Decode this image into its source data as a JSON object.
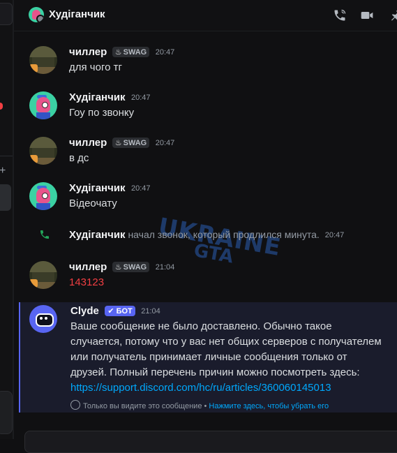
{
  "header": {
    "title": "Худіганчик"
  },
  "messages": [
    {
      "author": "чиллер",
      "tag": "SWAG",
      "time": "20:47",
      "text": "для чого тг"
    },
    {
      "author": "Худіганчик",
      "time": "20:47",
      "text": "Гоу по звонку"
    },
    {
      "author": "чиллер",
      "tag": "SWAG",
      "time": "20:47",
      "text": "в дс"
    },
    {
      "author": "Худіганчик",
      "time": "20:47",
      "text": "Відеочату"
    },
    {
      "author": "чиллер",
      "tag": "SWAG",
      "time": "21:04",
      "text": "143123"
    }
  ],
  "call": {
    "author": "Худіганчик",
    "text": "начал звонок, который продлился минута.",
    "time": "20:47"
  },
  "clyde": {
    "author": "Clyde",
    "badge": "✔ БОТ",
    "time": "21:04",
    "text": "Ваше сообщение не было доставлено. Обычно такое случается, потому что у вас нет общих серверов с получателем или получатель принимает личные сообщения только от друзей. Полный перечень причин можно посмотреть здесь:",
    "link": "https://support.discord.com/hc/ru/articles/360060145013",
    "ephemeral_note": "Только вы видите это сообщение •",
    "dismiss_label": "Нажмите здесь, чтобы убрать его"
  },
  "watermark": {
    "line1": "UKRAINE",
    "line2": "GTA"
  },
  "colors": {
    "accent": "#5865f2",
    "link": "#00a8fc",
    "error": "#f23f43",
    "call_green": "#23a55a"
  },
  "icons": [
    "phone-call-icon",
    "video-camera-icon",
    "pin-icon",
    "phone-icon",
    "eye-icon"
  ]
}
